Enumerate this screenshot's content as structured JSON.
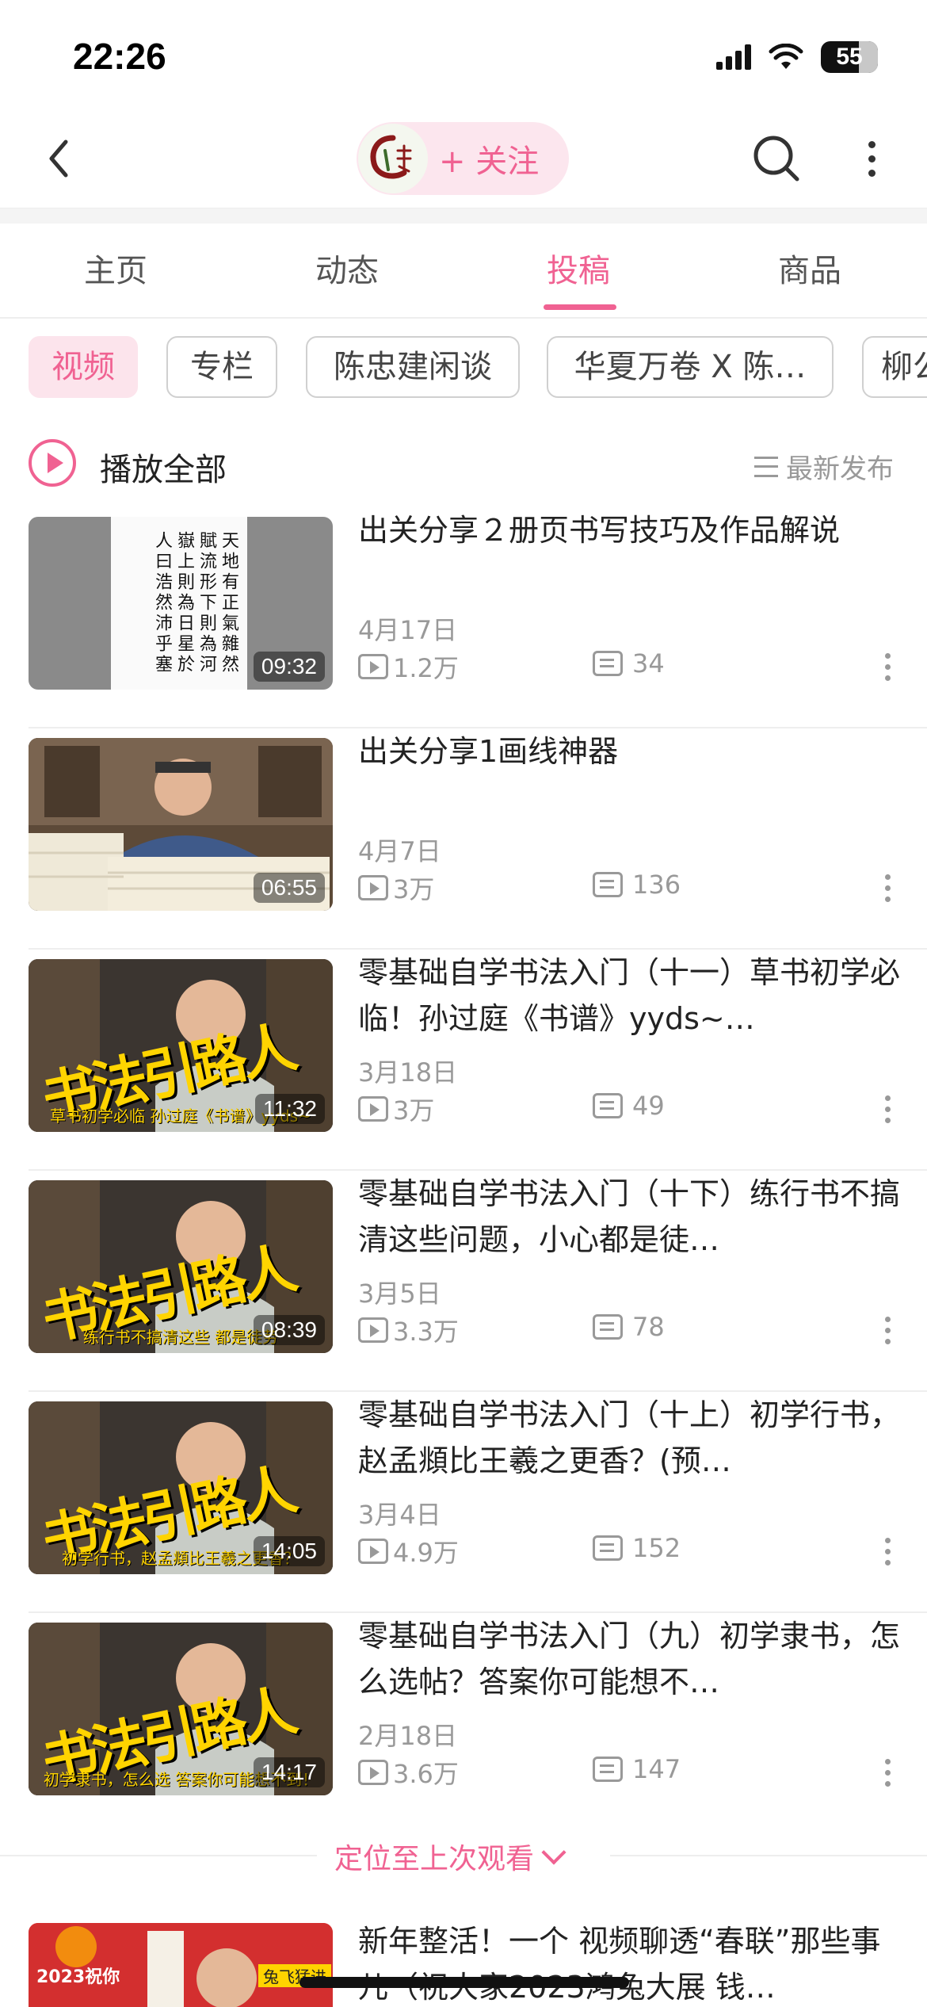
{
  "status_bar": {
    "time": "22:26",
    "battery": "55"
  },
  "nav": {
    "follow_label": "+ 关注"
  },
  "tabs": [
    {
      "label": "主页"
    },
    {
      "label": "动态"
    },
    {
      "label": "投稿",
      "active": true
    },
    {
      "label": "商品"
    }
  ],
  "chips": [
    {
      "label": "视频",
      "active": true
    },
    {
      "label": "专栏"
    },
    {
      "label": "陈忠建闲谈"
    },
    {
      "label": "华夏万卷 X 陈…"
    },
    {
      "label": "柳公"
    }
  ],
  "play_all": {
    "label": "播放全部",
    "sort_label": "最新发布"
  },
  "videos": [
    {
      "title": "出关分享２册页书写技巧及作品解说",
      "date": "4月17日",
      "views": "1.2万",
      "comments": "34",
      "duration": "09:32",
      "thumb_text": "天地有正氣雜然賦流形下則為河嶽上則為日星於人曰浩然沛乎塞"
    },
    {
      "title": "出关分享1画线神器",
      "date": "4月7日",
      "views": "3万",
      "comments": "136",
      "duration": "06:55"
    },
    {
      "title": "零基础自学书法入门（十一）草书初学必临！孙过庭《书谱》yyds~…",
      "date": "3月18日",
      "views": "3万",
      "comments": "49",
      "duration": "11:32",
      "thumb_caption": "草书初学必临 孙过庭《书谱》yyds~"
    },
    {
      "title": "零基础自学书法入门（十下）练行书不搞清这些问题，小心都是徒…",
      "date": "3月5日",
      "views": "3.3万",
      "comments": "78",
      "duration": "08:39",
      "thumb_caption": "练行书不搞清这些 都是徒劳"
    },
    {
      "title": "零基础自学书法入门（十上）初学行书，赵孟頫比王羲之更香？(预…",
      "date": "3月4日",
      "views": "4.9万",
      "comments": "152",
      "duration": "14:05",
      "thumb_caption": "初学行书，赵孟頫比王羲之更香？"
    },
    {
      "title": "零基础自学书法入门（九）初学隶书，怎么选帖？答案你可能想不…",
      "date": "2月18日",
      "views": "3.6万",
      "comments": "147",
      "duration": "14:17",
      "thumb_caption": "初学隶书，怎么选 答案你可能想不到！"
    }
  ],
  "thumb_overlay": "书法引路人",
  "locate": {
    "label": "定位至上次观看"
  },
  "last_video": {
    "title": "新年整活！一个 视频聊透“春联”那些事儿（祝大家2023鸿兔大展 钱…",
    "thumb_caption": "2023祝你",
    "thumb_tag": "兔飞猛进"
  }
}
